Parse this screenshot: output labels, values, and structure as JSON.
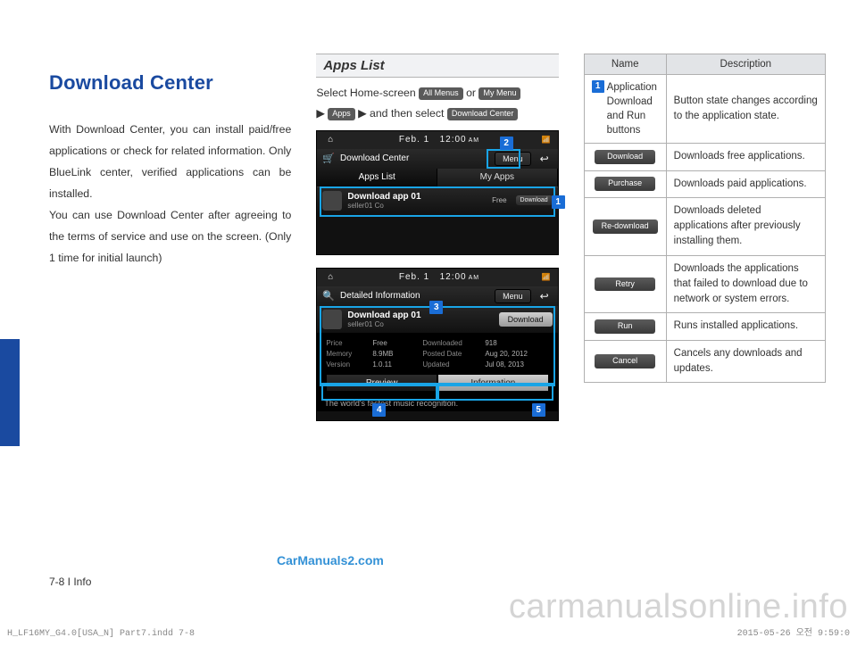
{
  "heading": "Download Center",
  "body": "With Download Center, you can install paid/free applications or check for related information. Only BlueLink center, verified applications can be installed.\nYou can use Download Center after agreeing to the terms of service and use on the screen. (Only 1 time for initial launch)",
  "section2_title": "Apps List",
  "instruction": {
    "pre": "Select Home-screen ",
    "chip_all_menus": "All Menus",
    "sep_or": " or ",
    "chip_my_menu": "My Menu",
    "line2_arrow": "▶ ",
    "chip_apps": "Apps",
    "line2_mid": " ▶ and then select ",
    "chip_dl": "Download Center"
  },
  "screenshot1": {
    "date": "Feb. 1",
    "time": "12:00",
    "ampm": "AM",
    "title": "Download Center",
    "menu": "Menu",
    "tab1": "Apps List",
    "tab2": "My Apps",
    "app_name": "Download app 01",
    "app_sub": "seller01 Co",
    "status": "Free",
    "btn": "Download"
  },
  "screenshot2": {
    "date": "Feb. 1",
    "time": "12:00",
    "ampm": "AM",
    "title": "Detailed Information",
    "menu": "Menu",
    "app_name": "Download app 01",
    "app_sub": "seller01 Co",
    "btn": "Download",
    "rows": [
      {
        "l": "Price",
        "v": "Free",
        "l2": "Downloaded",
        "v2": "918"
      },
      {
        "l": "Memory",
        "v": "8.9MB",
        "l2": "Posted Date",
        "v2": "Aug 20, 2012"
      },
      {
        "l": "Version",
        "v": "1.0.11",
        "l2": "Updated",
        "v2": "Jul 08, 2013"
      }
    ],
    "tab_preview": "Preview",
    "tab_info": "Information",
    "footer": "The world's fastest music recognition."
  },
  "callouts": {
    "c1": "1",
    "c2": "2",
    "c3": "3",
    "c4": "4",
    "c5": "5"
  },
  "table": {
    "h1": "Name",
    "h2": "Description",
    "rows": [
      {
        "badge": "1",
        "name": "Application Download and Run buttons",
        "desc": "Button state changes according to the application state."
      },
      {
        "pill": "Download",
        "desc": "Downloads free applications."
      },
      {
        "pill": "Purchase",
        "desc": "Downloads paid applications."
      },
      {
        "pill": "Re-download",
        "desc": "Downloads deleted applications after previously installing them."
      },
      {
        "pill": "Retry",
        "desc": "Downloads the applications that failed to download due to network or system errors."
      },
      {
        "pill": "Run",
        "desc": "Runs installed applications."
      },
      {
        "pill": "Cancel",
        "desc": "Cancels any downloads and updates."
      }
    ]
  },
  "watermark_link": "CarManuals2.com",
  "page_number": "7-8 I Info",
  "footer_left": "H_LF16MY_G4.0[USA_N] Part7.indd   7-8",
  "footer_right": "2015-05-26   오전 9:59:0",
  "big_watermark": "carmanualsonline.info"
}
